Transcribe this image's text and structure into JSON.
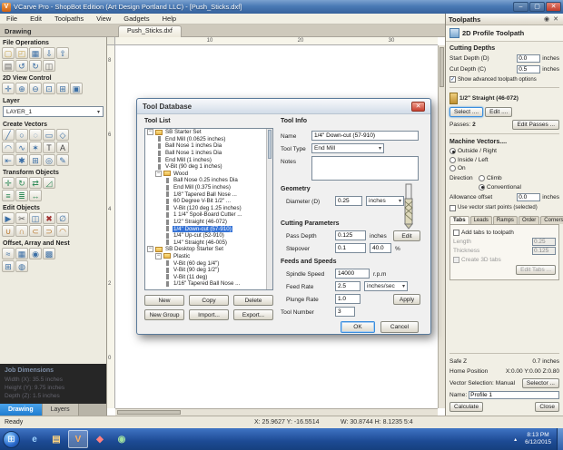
{
  "titlebar": {
    "title": "VCarve Pro - ShopBot Edition (Art Design Portland LLC) - [Push_Sticks.dxf]",
    "minimize": "–",
    "maximize": "▢",
    "close": "✕"
  },
  "menubar": {
    "items": [
      "File",
      "Edit",
      "Toolpaths",
      "View",
      "Gadgets",
      "Help"
    ]
  },
  "tabrow": {
    "panel_tab": "Drawing",
    "doc_tab": "Push_Sticks.dxf"
  },
  "canvas": {
    "ruler_top": [
      "10",
      "20",
      "30"
    ],
    "ruler_left": [
      "8",
      "6",
      "4",
      "2",
      "0"
    ]
  },
  "left_panel": {
    "tabs": [
      "Drawing",
      "Layers"
    ],
    "sections": [
      {
        "title": "File Operations",
        "rows": [
          [
            {
              "n": "new-drawing-icon",
              "g": "▢",
              "c": "#c8a44a"
            },
            {
              "n": "open-file-icon",
              "g": "◰",
              "c": "#c8a44a"
            },
            {
              "n": "save-file-icon",
              "g": "▦",
              "c": "#3a6ea5"
            },
            {
              "n": "import-vectors-icon",
              "g": "⇩",
              "c": "#3a6ea5"
            },
            {
              "n": "export-vectors-icon",
              "g": "⇧",
              "c": "#3a6ea5"
            }
          ],
          [
            {
              "n": "print-icon",
              "g": "▤",
              "c": "#666666"
            },
            {
              "n": "undo-icon",
              "g": "↺",
              "c": "#3a6ea5"
            },
            {
              "n": "redo-icon",
              "g": "↻",
              "c": "#3a6ea5"
            },
            {
              "n": "paste-icon",
              "g": "◫",
              "c": "#666666"
            }
          ]
        ]
      },
      {
        "title": "2D View Control",
        "rows": [
          [
            {
              "n": "pan-icon",
              "g": "✛",
              "c": "#3a6ea5"
            },
            {
              "n": "zoom-in-icon",
              "g": "⊕",
              "c": "#3a6ea5"
            },
            {
              "n": "zoom-out-icon",
              "g": "⊖",
              "c": "#3a6ea5"
            },
            {
              "n": "zoom-box-icon",
              "g": "⊡",
              "c": "#3a6ea5"
            },
            {
              "n": "zoom-extents-icon",
              "g": "⊞",
              "c": "#3a6ea5"
            },
            {
              "n": "zoom-selected-icon",
              "g": "▣",
              "c": "#3a6ea5"
            }
          ]
        ]
      },
      {
        "title": "Layer",
        "select": {
          "n": "layer-select",
          "value": "LAYER_1"
        }
      },
      {
        "title": "Create Vectors",
        "rows": [
          [
            {
              "n": "draw-line-icon",
              "g": "╱",
              "c": "#3a6ea5"
            },
            {
              "n": "draw-circle-icon",
              "g": "○",
              "c": "#3a6ea5"
            },
            {
              "n": "draw-ellipse-icon",
              "g": "◌",
              "c": "#3a6ea5"
            },
            {
              "n": "draw-rectangle-icon",
              "g": "▭",
              "c": "#3a6ea5"
            },
            {
              "n": "draw-polygon-icon",
              "g": "◇",
              "c": "#3a6ea5"
            }
          ],
          [
            {
              "n": "draw-arc-icon",
              "g": "◠",
              "c": "#3a6ea5"
            },
            {
              "n": "draw-curve-icon",
              "g": "∿",
              "c": "#3a6ea5"
            },
            {
              "n": "draw-star-icon",
              "g": "✶",
              "c": "#3a6ea5"
            },
            {
              "n": "text-tool-icon",
              "g": "T",
              "c": "#444444"
            },
            {
              "n": "text-on-curve-icon",
              "g": "A",
              "c": "#444444"
            }
          ],
          [
            {
              "n": "dimension-icon",
              "g": "⇤",
              "c": "#3a6ea5"
            },
            {
              "n": "gear-vector-icon",
              "g": "✱",
              "c": "#3a6ea5"
            },
            {
              "n": "grid-array-icon",
              "g": "⊞",
              "c": "#3a6ea5"
            },
            {
              "n": "snap-icon",
              "g": "◎",
              "c": "#3a6ea5"
            },
            {
              "n": "node-edit-icon",
              "g": "✎",
              "c": "#3a6ea5"
            }
          ]
        ]
      },
      {
        "title": "Transform Objects",
        "rows": [
          [
            {
              "n": "move-icon",
              "g": "✛",
              "c": "#2e8b57"
            },
            {
              "n": "rotate-icon",
              "g": "↻",
              "c": "#2e8b57"
            },
            {
              "n": "mirror-icon",
              "g": "⇄",
              "c": "#2e8b57"
            },
            {
              "n": "scale-icon",
              "g": "◿",
              "c": "#2e8b57"
            }
          ],
          [
            {
              "n": "align-icon",
              "g": "≡",
              "c": "#2e8b57"
            },
            {
              "n": "distribute-icon",
              "g": "≣",
              "c": "#2e8b57"
            },
            {
              "n": "stretch-icon",
              "g": "↔",
              "c": "#2e8b57"
            }
          ]
        ]
      },
      {
        "title": "Edit Objects",
        "rows": [
          [
            {
              "n": "select-icon",
              "g": "▶",
              "c": "#3a6ea5"
            },
            {
              "n": "scissors-icon",
              "g": "✂",
              "c": "#555555"
            },
            {
              "n": "duplicate-icon",
              "g": "◫",
              "c": "#3a6ea5"
            },
            {
              "n": "delete-icon",
              "g": "✖",
              "c": "#a03030"
            },
            {
              "n": "measure-icon",
              "g": "∅",
              "c": "#3a6ea5"
            }
          ],
          [
            {
              "n": "weld-icon",
              "g": "∪",
              "c": "#b8762a"
            },
            {
              "n": "subtract-icon",
              "g": "∩",
              "c": "#b8762a"
            },
            {
              "n": "trim-icon",
              "g": "⊂",
              "c": "#b8762a"
            },
            {
              "n": "extend-icon",
              "g": "⊃",
              "c": "#b8762a"
            },
            {
              "n": "fillet-icon",
              "g": "◠",
              "c": "#b8762a"
            }
          ]
        ]
      },
      {
        "title": "Offset, Array and Nest",
        "rows": [
          [
            {
              "n": "offset-icon",
              "g": "≈",
              "c": "#3a6ea5"
            },
            {
              "n": "array-copy-icon",
              "g": "▦",
              "c": "#3a6ea5"
            },
            {
              "n": "circular-array-icon",
              "g": "◉",
              "c": "#3a6ea5"
            },
            {
              "n": "nest-parts-icon",
              "g": "▩",
              "c": "#3a6ea5"
            }
          ],
          [
            {
              "n": "block-array-icon",
              "g": "⊞",
              "c": "#3a6ea5"
            },
            {
              "n": "copy-along-icon",
              "g": "◍",
              "c": "#3a6ea5"
            }
          ]
        ]
      }
    ]
  },
  "job_dimensions": {
    "title": "Job Dimensions",
    "width": "Width (X): 35.5 inches",
    "height": "Height (Y): 9.75 inches",
    "depth": "Depth (Z): 1.5 inches"
  },
  "dialog": {
    "title": "Tool Database",
    "close_glyph": "✕",
    "tool_list_label": "Tool List",
    "tree": [
      {
        "label": "SB Starter Set",
        "level": 0,
        "kind": "folder"
      },
      {
        "label": "End Mill (0.0625 inches)",
        "level": 1,
        "kind": "tool"
      },
      {
        "label": "Ball Nose 1 inches Dia",
        "level": 1,
        "kind": "tool"
      },
      {
        "label": "Ball Nose 1 inches Dia",
        "level": 1,
        "kind": "tool"
      },
      {
        "label": "End Mill (1 inches)",
        "level": 1,
        "kind": "tool"
      },
      {
        "label": "V-Bit (90 deg 1 inches)",
        "level": 1,
        "kind": "tool"
      },
      {
        "label": "Wood",
        "level": 1,
        "kind": "folder"
      },
      {
        "label": "Ball Nose 0.25 inches Dia",
        "level": 2,
        "kind": "tool"
      },
      {
        "label": "End Mill (0.375 inches)",
        "level": 2,
        "kind": "tool"
      },
      {
        "label": "1/8\" Tapered Ball Nose ...",
        "level": 2,
        "kind": "tool"
      },
      {
        "label": "60 Degree V-Bit 1/2\" ...",
        "level": 2,
        "kind": "tool"
      },
      {
        "label": "V-Bit (120 deg 1.25 inches)",
        "level": 2,
        "kind": "tool"
      },
      {
        "label": "1 1/4\" Spoil-Board Cutter ...",
        "level": 2,
        "kind": "tool"
      },
      {
        "label": "1/2\" Straight (46-072)",
        "level": 2,
        "kind": "tool"
      },
      {
        "label": "1/4\" Down-cut (57-910)",
        "level": 2,
        "kind": "tool",
        "selected": true
      },
      {
        "label": "1/4\" Up-cut (52-910)",
        "level": 2,
        "kind": "tool"
      },
      {
        "label": "1/4\" Straight (46-005)",
        "level": 2,
        "kind": "tool"
      },
      {
        "label": "SB Desktop Starter Set",
        "level": 0,
        "kind": "folder"
      },
      {
        "label": "Plastic",
        "level": 1,
        "kind": "folder"
      },
      {
        "label": "V-Bit (60 deg 1/4\")",
        "level": 2,
        "kind": "tool"
      },
      {
        "label": "V-Bit (90 deg 1/2\")",
        "level": 2,
        "kind": "tool"
      },
      {
        "label": "V-Bit (11 deg)",
        "level": 2,
        "kind": "tool"
      },
      {
        "label": "1/16\" Tapered Ball Nose ...",
        "level": 2,
        "kind": "tool"
      }
    ],
    "buttons": {
      "new": "New",
      "copy": "Copy",
      "delete": "Delete",
      "new_group": "New Group",
      "import": "Import...",
      "export": "Export..."
    },
    "tool_info": {
      "title": "Tool Info",
      "name_label": "Name",
      "name": "1/4\" Down-cut (57-910)",
      "type_label": "Tool Type",
      "type": "End Mill",
      "notes_label": "Notes"
    },
    "geometry": {
      "title": "Geometry",
      "diameter_label": "Diameter (D)",
      "diameter": "0.25",
      "units": "inches"
    },
    "cutting": {
      "title": "Cutting Parameters",
      "pass_depth_label": "Pass Depth",
      "pass_depth": "0.125",
      "stepover_label": "Stepover",
      "stepover": "0.1",
      "stepover_pct": "40.0",
      "pct": "%",
      "units": "inches",
      "edit_btn": "Edit"
    },
    "feeds": {
      "title": "Feeds and Speeds",
      "spindle_label": "Spindle Speed",
      "spindle": "14000",
      "spindle_units": "r.p.m",
      "feed_label": "Feed Rate",
      "feed": "2.5",
      "feed_units": "inches/sec",
      "plunge_label": "Plunge Rate",
      "plunge": "1.0",
      "apply_btn": "Apply"
    },
    "tool_number_label": "Tool Number",
    "tool_number": "3",
    "ok_btn": "OK",
    "cancel_btn": "Cancel"
  },
  "toolpaths": {
    "header": "Toolpaths",
    "title": "2D Profile Toolpath",
    "cutting_depths": {
      "title": "Cutting Depths",
      "start_depth_label": "Start Depth (D)",
      "start_depth": "0.0",
      "cut_depth_label": "Cut Depth (C)",
      "cut_depth": "0.5",
      "units": "inches",
      "advanced_label": "Show advanced toolpath options"
    },
    "tool": {
      "name": "1/2\" Straight  (46-072)",
      "select_btn": "Select ....",
      "edit_btn": "Edit ....",
      "passes_label": "Passes:",
      "passes": "2",
      "edit_passes_btn": "Edit Passes ..."
    },
    "machine_vectors": {
      "title": "Machine Vectors....",
      "options": [
        "Outside / Right",
        "Inside / Left",
        "On"
      ],
      "selected": 0,
      "direction_label": "Direction",
      "direction_options": [
        "Climb",
        "Conventional"
      ],
      "direction_selected": 1,
      "allowance_label": "Allowance offset",
      "allowance": "0.0",
      "units": "inches",
      "start_points_label": "Use vector start points (selected)"
    },
    "tabs_section": {
      "tabs": [
        "Tabs",
        "Leads",
        "Ramps",
        "Order",
        "Corners"
      ],
      "active": 0,
      "add_tabs_label": "Add tabs to toolpath",
      "length_label": "Length",
      "length": "0.25",
      "thickness_label": "Thickness",
      "thickness": "0.125",
      "create3d_label": "Create 3D tabs",
      "edit_tabs_btn": "Edit Tabs ..."
    },
    "footer": {
      "safe_z_label": "Safe Z",
      "safe_z": "0.7 inches",
      "home_label": "Home Position",
      "home": "X:0.00 Y:0.00 Z:0.80",
      "vector_sel_label": "Vector Selection:",
      "vector_sel": "Manual",
      "selector_btn": "Selector ...",
      "name_label": "Name:",
      "name": "Profile 1",
      "calculate_btn": "Calculate",
      "close_btn": "Close"
    }
  },
  "statusbar": {
    "ready": "Ready",
    "coords": "X: 25.9627    Y: -16.5514",
    "dims": "W: 30.8744    H: 8.1235    5:4"
  },
  "taskbar": {
    "start": "⊞",
    "tray_arrow": "▴",
    "time": "8:13 PM",
    "date": "6/12/2015",
    "icons": [
      {
        "n": "taskbar-browser-icon",
        "g": "e",
        "c": "#9fd4ff"
      },
      {
        "n": "taskbar-explorer-icon",
        "g": "▤",
        "c": "#ffd580"
      },
      {
        "n": "taskbar-vcarve-icon",
        "g": "V",
        "c": "#ffb060",
        "active": true
      },
      {
        "n": "taskbar-shopbot-icon",
        "g": "◆",
        "c": "#ff8080"
      },
      {
        "n": "taskbar-media-icon",
        "g": "◉",
        "c": "#a0e0a0"
      }
    ]
  }
}
